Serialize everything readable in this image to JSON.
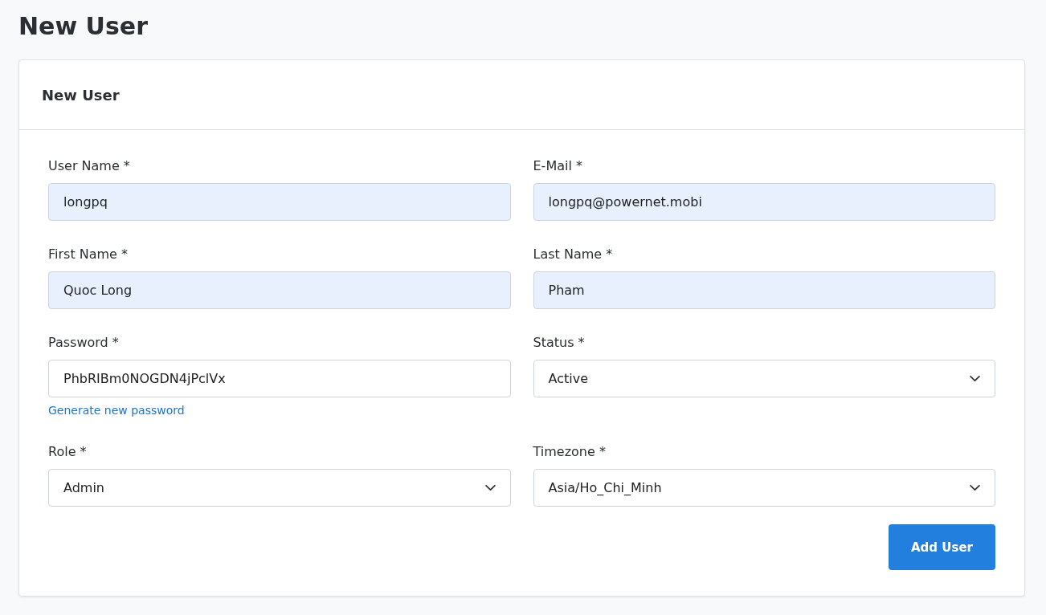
{
  "page_title": "New User",
  "card": {
    "title": "New User",
    "fields": [
      {
        "kind": "text",
        "label": "User Name *",
        "value": "longpq",
        "autofilled": true
      },
      {
        "kind": "text",
        "label": "E-Mail *",
        "value": "longpq@powernet.mobi",
        "autofilled": true
      },
      {
        "kind": "text",
        "label": "First Name *",
        "value": "Quoc Long",
        "autofilled": true
      },
      {
        "kind": "text",
        "label": "Last Name *",
        "value": "Pham",
        "autofilled": true
      },
      {
        "kind": "text",
        "label": "Password *",
        "value": "PhbRIBm0NOGDN4jPclVx",
        "autofilled": false,
        "link": "Generate new password"
      },
      {
        "kind": "select",
        "label": "Status *",
        "value": "Active"
      },
      {
        "kind": "select",
        "label": "Role *",
        "value": "Admin"
      },
      {
        "kind": "select",
        "label": "Timezone *",
        "value": "Asia/Ho_Chi_Minh"
      }
    ],
    "submit": "Add User"
  }
}
